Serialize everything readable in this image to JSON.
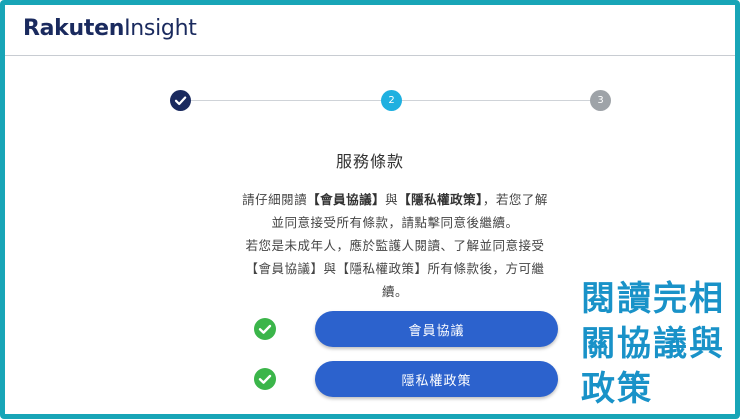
{
  "brand": {
    "name_bold": "Rakuten",
    "name_light": "Insight"
  },
  "stepper": {
    "steps": [
      {
        "label": "✓",
        "state": "completed",
        "color": "#1a2a5e"
      },
      {
        "label": "2",
        "state": "current",
        "color": "#1fb0e0"
      },
      {
        "label": "3",
        "state": "upcoming",
        "color": "#9ea3a8"
      }
    ]
  },
  "terms": {
    "title": "服務條款",
    "desc": {
      "l1_a": "請仔細閱讀",
      "l1_b": "【會員協議】",
      "l1_c": "與",
      "l1_d": "【隱私權政策】",
      "l1_e": "，若您了解",
      "l2": "並同意接受所有條款，請點擊同意後繼續。",
      "l3": "若您是未成年人，應於監護人閱讀、了解並同意接受",
      "l4": "【會員協議】與【隱私權政策】所有條款後，方可繼",
      "l5": "續。"
    },
    "buttons": [
      {
        "label": "會員協議",
        "checked": true
      },
      {
        "label": "隱私權政策",
        "checked": true
      }
    ]
  },
  "annotation": {
    "lines": [
      "閱讀完相",
      "關協議與",
      "政策"
    ],
    "color": "#1992c8"
  },
  "colors": {
    "frame": "#18a5b7",
    "button": "#2c62cd",
    "check": "#3bb54a"
  }
}
